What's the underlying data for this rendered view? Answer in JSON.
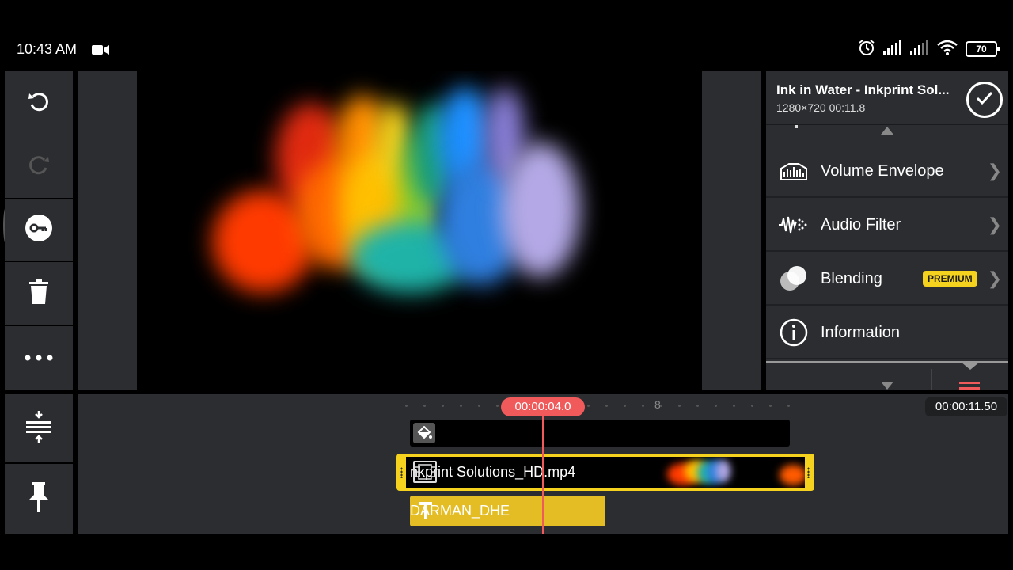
{
  "status_bar": {
    "time": "10:43 AM",
    "battery": "70"
  },
  "left_toolbar": {
    "undo": "undo-icon",
    "redo": "redo-icon",
    "keyframe": "key-icon",
    "delete": "trash-icon",
    "more": "more-icon",
    "layout": "timeline-layout-icon",
    "pin": "pin-icon"
  },
  "clip_panel": {
    "title": "Ink in Water  - Inkprint Sol...",
    "meta": "1280×720  00:11.8",
    "items": [
      {
        "label": "Volume Envelope",
        "icon": "volume-envelope-icon"
      },
      {
        "label": "Audio Filter",
        "icon": "audio-filter-icon"
      },
      {
        "label": "Blending",
        "icon": "blending-icon",
        "badge": "PREMIUM"
      },
      {
        "label": "Information",
        "icon": "info-icon"
      }
    ]
  },
  "timeline": {
    "playhead_time": "00:00:04.0",
    "total_time": "00:00:11.50",
    "tick_label": "8",
    "video_clip_label": "nkprint Solutions_HD.mp4",
    "text_clip_label": "DARMAN_DHE"
  },
  "colors": {
    "accent": "#f5d21e",
    "playhead": "#f05a5a",
    "panel": "#2b2d31"
  }
}
